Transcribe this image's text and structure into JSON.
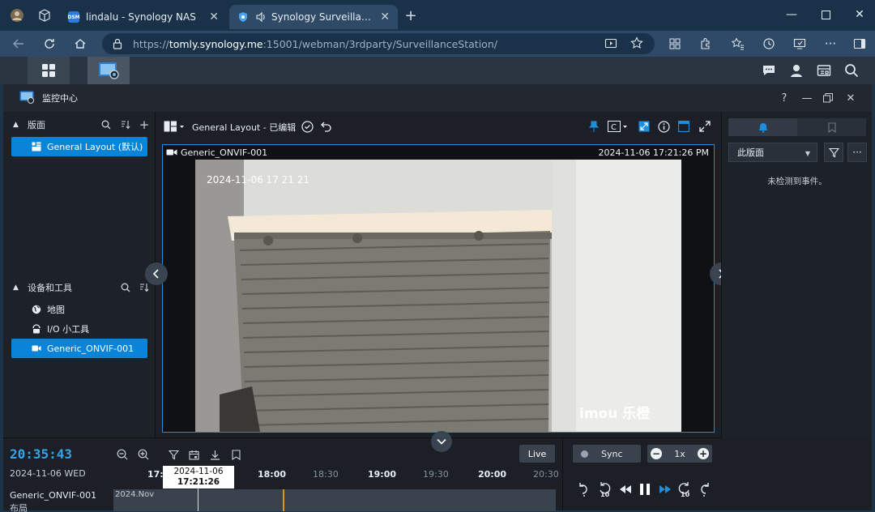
{
  "browser": {
    "tabs": [
      {
        "title": "lindalu - Synology NAS",
        "favicon": "DSM"
      },
      {
        "title": "Synology Surveillance Station"
      }
    ],
    "url": {
      "scheme": "https://",
      "host": "tomly.synology.me",
      "path": ":15001/webman/3rdparty/SurveillanceStation/"
    }
  },
  "app": {
    "title": "监控中心"
  },
  "left": {
    "layouts": {
      "title": "版面",
      "items": [
        {
          "label": "General Layout (默认)",
          "selected": true
        }
      ]
    },
    "devices": {
      "title": "设备和工具",
      "items": [
        {
          "label": "地图",
          "icon": "globe-icon"
        },
        {
          "label": "I/O 小工具",
          "icon": "io-module-icon"
        },
        {
          "label": "Generic_ONVIF-001",
          "icon": "camera-icon",
          "selected": true
        }
      ]
    }
  },
  "toolbar": {
    "layout_name": "General Layout - 已编辑"
  },
  "viewer": {
    "camera_name": "Generic_ONVIF-001",
    "timestamp": "2024-11-06 17:21:26 PM",
    "osd_time": "2024-11-06 17 21 21",
    "watermark": "imou 乐橙"
  },
  "right": {
    "filter_value": "此版面",
    "no_events": "未检测到事件。"
  },
  "timeline": {
    "clock": "20:35:43",
    "date": "2024-11-06 WED",
    "live_label": "Live",
    "tooltip_date": "2024-11-06",
    "tooltip_time": "17:21:26",
    "ticks": [
      {
        "label": "17:0",
        "major": true
      },
      {
        "label": "18:00",
        "major": true
      },
      {
        "label": "18:30",
        "major": false
      },
      {
        "label": "19:00",
        "major": true
      },
      {
        "label": "19:30",
        "major": false
      },
      {
        "label": "20:00",
        "major": true
      },
      {
        "label": "20:30",
        "major": false
      }
    ],
    "track_name": "Generic_ONVIF-001",
    "track_sub": "布局",
    "track_month": "2024.Nov"
  },
  "playback": {
    "sync_label": "Sync",
    "speed": "1x",
    "skip_seconds": "10"
  },
  "colors": {
    "accent": "#0a84d8",
    "clock": "#34a4f0",
    "viewer_border": "#1d8fe0",
    "recording": "#d39a28"
  }
}
